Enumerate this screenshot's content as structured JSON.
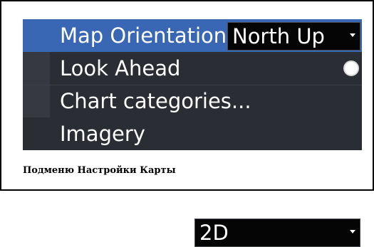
{
  "menu": {
    "map_orientation": {
      "label": "Map Orientation",
      "value": "North Up"
    },
    "look_ahead": {
      "label": "Look Ahead",
      "enabled": false
    },
    "chart_categories": {
      "label": "Chart categories..."
    },
    "imagery": {
      "label": "Imagery",
      "value": "2D"
    }
  },
  "caption": "Подменю Настройки Карты",
  "colors": {
    "menu_bg": "#2b2d34",
    "highlight": "#3967b4",
    "dropdown_bg": "#050505",
    "text": "#ffffff"
  }
}
